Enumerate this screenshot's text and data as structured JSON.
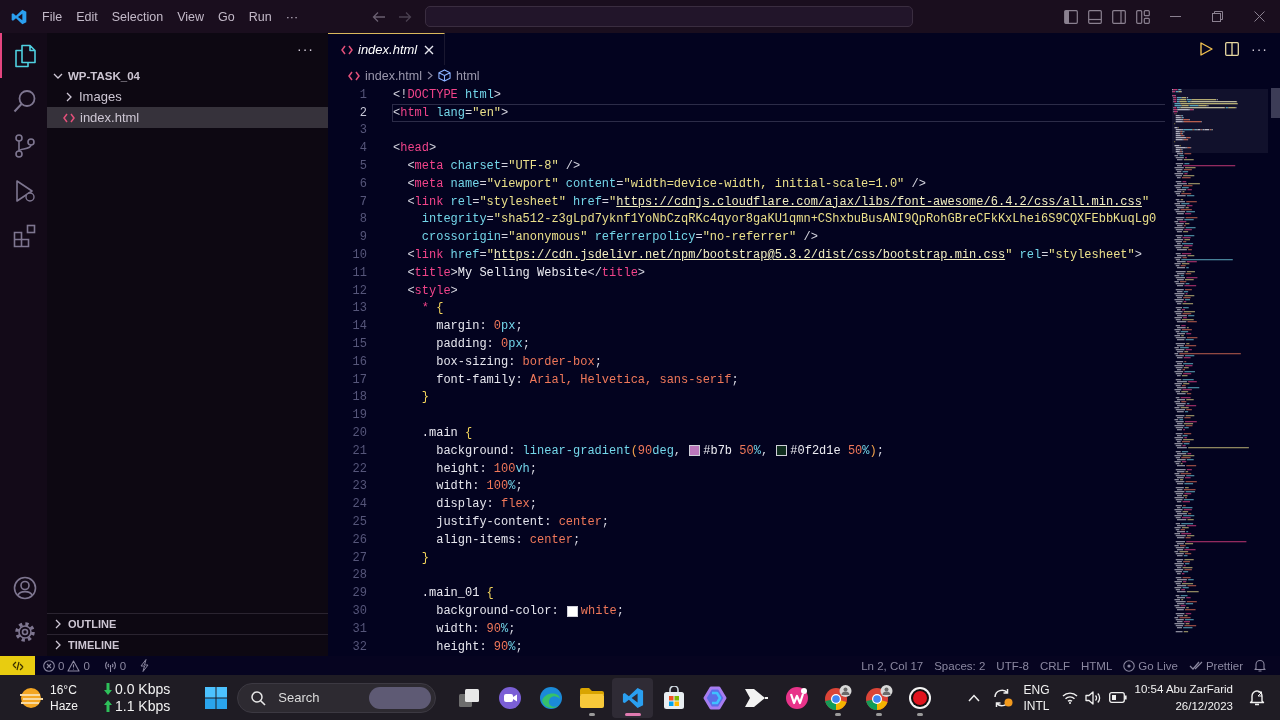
{
  "title_bar": {
    "menu": [
      "File",
      "Edit",
      "Selection",
      "View",
      "Go",
      "Run",
      "···"
    ]
  },
  "activity_bar": {
    "items": [
      {
        "selected": true
      },
      {
        "selected": false
      },
      {
        "selected": false
      },
      {
        "selected": false
      },
      {
        "selected": false
      }
    ]
  },
  "explorer": {
    "more": "···",
    "folder": {
      "name": "WP-TASK_04",
      "expanded": true,
      "children": [
        {
          "name": "Images",
          "kind": "folder",
          "expanded": false,
          "selected": false
        },
        {
          "name": "index.html",
          "kind": "file",
          "selected": true
        }
      ]
    },
    "sections": [
      {
        "name": "OUTLINE",
        "expanded": false
      },
      {
        "name": "TIMELINE",
        "expanded": false
      }
    ]
  },
  "editor": {
    "tabs": [
      {
        "label": "index.html",
        "selected": true,
        "preview": true
      }
    ],
    "more": "···",
    "breadcrumbs": [
      {
        "kind": "file",
        "text": "index.html"
      },
      {
        "kind": "element",
        "text": "html"
      }
    ],
    "lines": [
      {
        "number": "1",
        "current": false,
        "tokens": [
          {
            "kind": "punct",
            "text": "<!"
          },
          {
            "kind": "tag",
            "text": "DOCTYPE"
          },
          {
            "kind": "attr",
            "text": " html"
          },
          {
            "kind": "punct",
            "text": ">"
          }
        ]
      },
      {
        "number": "2",
        "current": true,
        "tokens": [
          {
            "kind": "punct",
            "text": "<"
          },
          {
            "kind": "tag",
            "text": "html"
          },
          {
            "kind": "attr",
            "text": " lang"
          },
          {
            "kind": "punct",
            "text": "="
          },
          {
            "kind": "str",
            "text": "\"en\""
          },
          {
            "kind": "punct",
            "text": ">"
          }
        ]
      },
      {
        "number": "3",
        "current": false
      },
      {
        "number": "4",
        "current": false,
        "tokens": [
          {
            "kind": "punct",
            "text": "<"
          },
          {
            "kind": "tag",
            "text": "head"
          },
          {
            "kind": "punct",
            "text": ">"
          }
        ]
      },
      {
        "number": "5",
        "current": false,
        "tokens": [
          {
            "kind": "punct",
            "text": "  <"
          },
          {
            "kind": "tag",
            "text": "meta"
          },
          {
            "kind": "attr",
            "text": " charset"
          },
          {
            "kind": "punct",
            "text": "="
          },
          {
            "kind": "str",
            "text": "\"UTF-8\""
          },
          {
            "kind": "punct",
            "text": " />"
          }
        ]
      },
      {
        "number": "6",
        "current": false,
        "tokens": [
          {
            "kind": "punct",
            "text": "  <"
          },
          {
            "kind": "tag",
            "text": "meta"
          },
          {
            "kind": "attr",
            "text": " name"
          },
          {
            "kind": "punct",
            "text": "="
          },
          {
            "kind": "str",
            "text": "\"viewport\""
          },
          {
            "kind": "attr",
            "text": " content"
          },
          {
            "kind": "punct",
            "text": "="
          },
          {
            "kind": "str",
            "text": "\"width=device-width, initial-scale=1.0\""
          },
          {
            "kind": "punct",
            "text": " />"
          }
        ]
      },
      {
        "number": "7",
        "current": false,
        "tokens": [
          {
            "kind": "punct",
            "text": "  <"
          },
          {
            "kind": "tag",
            "text": "link"
          },
          {
            "kind": "attr",
            "text": " rel"
          },
          {
            "kind": "punct",
            "text": "="
          },
          {
            "kind": "str",
            "text": "\"stylesheet\""
          },
          {
            "kind": "attr",
            "text": " href"
          },
          {
            "kind": "punct",
            "text": "="
          },
          {
            "kind": "str",
            "text": "\""
          },
          {
            "kind": "url",
            "text": "https://cdnjs.cloudflare.com/ajax/libs/font-awesome/6.4.2/css/all.min.css"
          },
          {
            "kind": "str",
            "text": "\""
          }
        ]
      },
      {
        "number": "8",
        "current": false,
        "tokens": [
          {
            "kind": "attr",
            "text": "    integrity"
          },
          {
            "kind": "punct",
            "text": "="
          },
          {
            "kind": "str",
            "text": "\"sha512-z3gLpd7yknf1YoNbCzqRKc4qyor8gaKU1qmn+CShxbuBusANI9QpRohGBreCFkKxLhei6S9CQXFEbbKuqLg0"
          }
        ]
      },
      {
        "number": "9",
        "current": false,
        "tokens": [
          {
            "kind": "attr",
            "text": "    crossorigin"
          },
          {
            "kind": "punct",
            "text": "="
          },
          {
            "kind": "str",
            "text": "\"anonymous\""
          },
          {
            "kind": "attr",
            "text": " referrerpolicy"
          },
          {
            "kind": "punct",
            "text": "="
          },
          {
            "kind": "str",
            "text": "\"no-referrer\""
          },
          {
            "kind": "punct",
            "text": " />"
          }
        ]
      },
      {
        "number": "10",
        "current": false,
        "tokens": [
          {
            "kind": "punct",
            "text": "  <"
          },
          {
            "kind": "tag",
            "text": "link"
          },
          {
            "kind": "attr",
            "text": " href"
          },
          {
            "kind": "punct",
            "text": "="
          },
          {
            "kind": "str",
            "text": "\""
          },
          {
            "kind": "url",
            "text": "https://cdn.jsdelivr.net/npm/bootstrap@5.3.2/dist/css/bootstrap.min.css"
          },
          {
            "kind": "str",
            "text": "\""
          },
          {
            "kind": "attr",
            "text": " rel"
          },
          {
            "kind": "punct",
            "text": "="
          },
          {
            "kind": "str",
            "text": "\"stylesheet\""
          },
          {
            "kind": "punct",
            "text": ">"
          }
        ]
      },
      {
        "number": "11",
        "current": false,
        "tokens": [
          {
            "kind": "punct",
            "text": "  <"
          },
          {
            "kind": "tag",
            "text": "title"
          },
          {
            "kind": "punct",
            "text": ">"
          },
          {
            "kind": "text",
            "text": "My Selling Website"
          },
          {
            "kind": "punct",
            "text": "</"
          },
          {
            "kind": "tag",
            "text": "title"
          },
          {
            "kind": "punct",
            "text": ">"
          }
        ]
      },
      {
        "number": "12",
        "current": false,
        "tokens": [
          {
            "kind": "punct",
            "text": "  <"
          },
          {
            "kind": "tag",
            "text": "style"
          },
          {
            "kind": "punct",
            "text": ">"
          }
        ]
      },
      {
        "number": "13",
        "current": false,
        "tokens": [
          {
            "kind": "tag",
            "text": "    *"
          },
          {
            "kind": "brace",
            "text": " {"
          }
        ]
      },
      {
        "number": "14",
        "current": false,
        "tokens": [
          {
            "kind": "prop",
            "text": "      margin"
          },
          {
            "kind": "punct",
            "text": ": "
          },
          {
            "kind": "num",
            "text": "0"
          },
          {
            "kind": "unit",
            "text": "px"
          },
          {
            "kind": "punct",
            "text": ";"
          }
        ]
      },
      {
        "number": "15",
        "current": false,
        "tokens": [
          {
            "kind": "prop",
            "text": "      padding"
          },
          {
            "kind": "punct",
            "text": ": "
          },
          {
            "kind": "num",
            "text": "0"
          },
          {
            "kind": "unit",
            "text": "px"
          },
          {
            "kind": "punct",
            "text": ";"
          }
        ]
      },
      {
        "number": "16",
        "current": false,
        "tokens": [
          {
            "kind": "prop",
            "text": "      box-sizing"
          },
          {
            "kind": "punct",
            "text": ": "
          },
          {
            "kind": "val",
            "text": "border-box"
          },
          {
            "kind": "punct",
            "text": ";"
          }
        ]
      },
      {
        "number": "17",
        "current": false,
        "tokens": [
          {
            "kind": "prop",
            "text": "      font-family"
          },
          {
            "kind": "punct",
            "text": ": "
          },
          {
            "kind": "val",
            "text": "Arial, Helvetica, sans-serif"
          },
          {
            "kind": "punct",
            "text": ";"
          }
        ]
      },
      {
        "number": "18",
        "current": false,
        "tokens": [
          {
            "kind": "brace",
            "text": "    }"
          }
        ]
      },
      {
        "number": "19",
        "current": false
      },
      {
        "number": "20",
        "current": false,
        "tokens": [
          {
            "kind": "sel",
            "text": "    .main"
          },
          {
            "kind": "brace",
            "text": " {"
          }
        ]
      },
      {
        "number": "21",
        "current": false,
        "tokens": [
          {
            "kind": "prop",
            "text": "      background"
          },
          {
            "kind": "punct",
            "text": ": "
          },
          {
            "kind": "fn",
            "text": "linear-gradient"
          },
          {
            "kind": "paren",
            "text": "("
          },
          {
            "kind": "num",
            "text": "90"
          },
          {
            "kind": "unit",
            "text": "deg"
          },
          {
            "kind": "punct",
            "text": ", "
          },
          {
            "kind": "swatch",
            "color": "#bb77bb"
          },
          {
            "kind": "text",
            "text": "#b7b"
          },
          {
            "kind": "num",
            "text": " 50"
          },
          {
            "kind": "unit",
            "text": "%"
          },
          {
            "kind": "punct",
            "text": ", "
          },
          {
            "kind": "swatch",
            "color": "#0f2d1e"
          },
          {
            "kind": "text",
            "text": "#0f2d1e"
          },
          {
            "kind": "num",
            "text": " 50"
          },
          {
            "kind": "unit",
            "text": "%"
          },
          {
            "kind": "paren",
            "text": ")"
          },
          {
            "kind": "punct",
            "text": ";"
          }
        ]
      },
      {
        "number": "22",
        "current": false,
        "tokens": [
          {
            "kind": "prop",
            "text": "      height"
          },
          {
            "kind": "punct",
            "text": ": "
          },
          {
            "kind": "num",
            "text": "100"
          },
          {
            "kind": "unit",
            "text": "vh"
          },
          {
            "kind": "punct",
            "text": ";"
          }
        ]
      },
      {
        "number": "23",
        "current": false,
        "tokens": [
          {
            "kind": "prop",
            "text": "      width"
          },
          {
            "kind": "punct",
            "text": ": "
          },
          {
            "kind": "num",
            "text": "100"
          },
          {
            "kind": "unit",
            "text": "%"
          },
          {
            "kind": "punct",
            "text": ";"
          }
        ]
      },
      {
        "number": "24",
        "current": false,
        "tokens": [
          {
            "kind": "prop",
            "text": "      display"
          },
          {
            "kind": "punct",
            "text": ": "
          },
          {
            "kind": "val",
            "text": "flex"
          },
          {
            "kind": "punct",
            "text": ";"
          }
        ]
      },
      {
        "number": "25",
        "current": false,
        "tokens": [
          {
            "kind": "prop",
            "text": "      justify-content"
          },
          {
            "kind": "punct",
            "text": ": "
          },
          {
            "kind": "val",
            "text": "center"
          },
          {
            "kind": "punct",
            "text": ";"
          }
        ]
      },
      {
        "number": "26",
        "current": false,
        "tokens": [
          {
            "kind": "prop",
            "text": "      align-items"
          },
          {
            "kind": "punct",
            "text": ": "
          },
          {
            "kind": "val",
            "text": "center"
          },
          {
            "kind": "punct",
            "text": ";"
          }
        ]
      },
      {
        "number": "27",
        "current": false,
        "tokens": [
          {
            "kind": "brace",
            "text": "    }"
          }
        ]
      },
      {
        "number": "28",
        "current": false
      },
      {
        "number": "29",
        "current": false,
        "tokens": [
          {
            "kind": "sel",
            "text": "    .main_01"
          },
          {
            "kind": "brace",
            "text": " {"
          }
        ]
      },
      {
        "number": "30",
        "current": false,
        "tokens": [
          {
            "kind": "prop",
            "text": "      background-color"
          },
          {
            "kind": "punct",
            "text": ": "
          },
          {
            "kind": "swatch",
            "color": "#ffffff"
          },
          {
            "kind": "val",
            "text": "white"
          },
          {
            "kind": "punct",
            "text": ";"
          }
        ]
      },
      {
        "number": "31",
        "current": false,
        "tokens": [
          {
            "kind": "prop",
            "text": "      width"
          },
          {
            "kind": "punct",
            "text": ": "
          },
          {
            "kind": "num",
            "text": "90"
          },
          {
            "kind": "unit",
            "text": "%"
          },
          {
            "kind": "punct",
            "text": ";"
          }
        ]
      },
      {
        "number": "32",
        "current": false,
        "tokens": [
          {
            "kind": "prop",
            "text": "      height"
          },
          {
            "kind": "punct",
            "text": ": "
          },
          {
            "kind": "num",
            "text": "90"
          },
          {
            "kind": "unit",
            "text": "%"
          },
          {
            "kind": "punct",
            "text": ";"
          }
        ]
      }
    ]
  },
  "status_bar": {
    "errors": "0",
    "warnings": "0",
    "ports": "0",
    "items": [
      {
        "kind": "plain",
        "text": "Ln 2, Col 17"
      },
      {
        "kind": "plain",
        "text": "Spaces: 2"
      },
      {
        "kind": "plain",
        "text": "UTF-8"
      },
      {
        "kind": "plain",
        "text": "CRLF"
      },
      {
        "kind": "plain",
        "text": "HTML"
      },
      {
        "kind": "live",
        "text": "Go Live"
      },
      {
        "kind": "format",
        "text": "Prettier"
      }
    ]
  },
  "taskbar": {
    "weather": {
      "temperature": "16°C",
      "condition": "Haze"
    },
    "network": {
      "download": "0.0 Kbps",
      "upload": "1.1 Kbps"
    },
    "search": {
      "placeholder": "Search"
    },
    "apps": [
      {
        "kind": "taskview",
        "running": false,
        "selected": false
      },
      {
        "kind": "meet",
        "running": false,
        "selected": false
      },
      {
        "kind": "edge",
        "running": false,
        "selected": false
      },
      {
        "kind": "explorer",
        "running": true,
        "selected": false
      },
      {
        "kind": "vscode",
        "running": true,
        "selected": true
      },
      {
        "kind": "store",
        "running": false,
        "selected": false
      },
      {
        "kind": "copilot",
        "running": false,
        "selected": false
      },
      {
        "kind": "arrow",
        "running": false,
        "selected": false
      },
      {
        "kind": "wps",
        "running": false,
        "selected": false
      },
      {
        "kind": "chrome",
        "running": true,
        "selected": false
      },
      {
        "kind": "chrome",
        "running": true,
        "selected": false
      },
      {
        "kind": "recorder",
        "running": true,
        "selected": false
      }
    ],
    "tray": {
      "language": "ENG",
      "layout": "INTL",
      "time": "10:54 Abu ZarFarid",
      "date": "26/12/2023"
    }
  }
}
